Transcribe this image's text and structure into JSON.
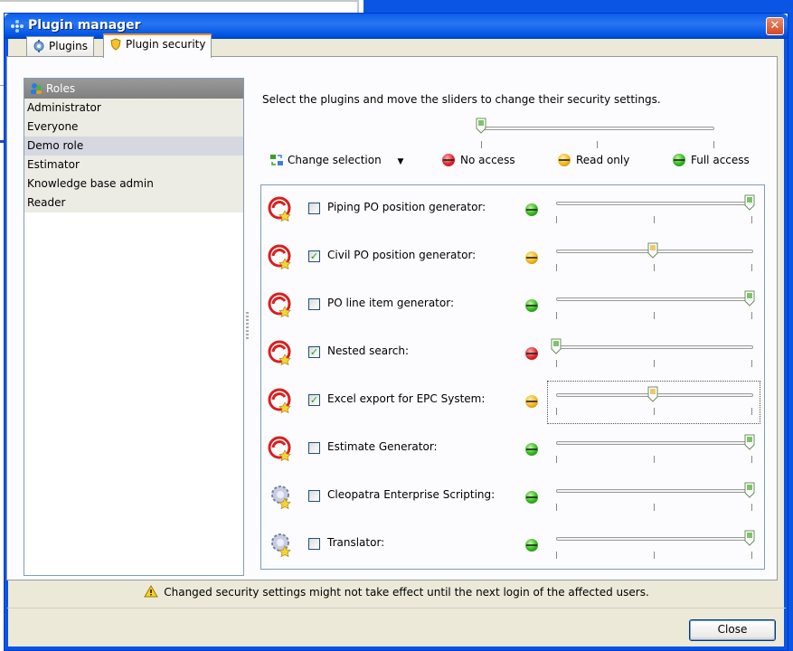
{
  "window": {
    "title": "Plugin manager",
    "close_glyph": "✕"
  },
  "tabs": [
    {
      "label": "Plugins",
      "icon": "plugins-gear-icon"
    },
    {
      "label": "Plugin security",
      "icon": "shield-icon",
      "active": true
    }
  ],
  "roles": {
    "header": "Roles",
    "items": [
      "Administrator",
      "Everyone",
      "Demo role",
      "Estimator",
      "Knowledge base admin",
      "Reader"
    ],
    "selected": "Demo role"
  },
  "instructions": "Select the plugins and move the sliders to change their security settings.",
  "master_slider": {
    "level": 0
  },
  "change_selection": {
    "label": "Change selection",
    "icon": "change-selection-icon"
  },
  "legend": [
    {
      "label": "No access",
      "color": "#e2242a"
    },
    {
      "label": "Read only",
      "color": "#f2b51b"
    },
    {
      "label": "Full access",
      "color": "#2db81e"
    }
  ],
  "plugins": [
    {
      "name": "Piping PO position generator:",
      "checked": false,
      "access": "full",
      "level": 1.0,
      "icon": "plugin-swirl-icon"
    },
    {
      "name": "Civil PO position generator:",
      "checked": true,
      "access": "read",
      "level": 0.5,
      "icon": "plugin-swirl-icon"
    },
    {
      "name": "PO line item generator:",
      "checked": false,
      "access": "full",
      "level": 1.0,
      "icon": "plugin-swirl-icon"
    },
    {
      "name": "Nested search:",
      "checked": true,
      "access": "none",
      "level": 0.0,
      "icon": "plugin-swirl-icon"
    },
    {
      "name": "Excel export for EPC System:",
      "checked": true,
      "access": "read",
      "level": 0.5,
      "icon": "plugin-swirl-icon",
      "focused": true
    },
    {
      "name": "Estimate Generator:",
      "checked": false,
      "access": "full",
      "level": 1.0,
      "icon": "plugin-swirl-icon"
    },
    {
      "name": "Cleopatra Enterprise Scripting:",
      "checked": false,
      "access": "full",
      "level": 1.0,
      "icon": "plugin-gear-star-icon"
    },
    {
      "name": "Translator:",
      "checked": false,
      "access": "full",
      "level": 1.0,
      "icon": "plugin-gear-star-icon"
    }
  ],
  "footer": {
    "warning": "Changed security settings might not take effect until the next login of the affected users.",
    "close_label": "Close"
  }
}
